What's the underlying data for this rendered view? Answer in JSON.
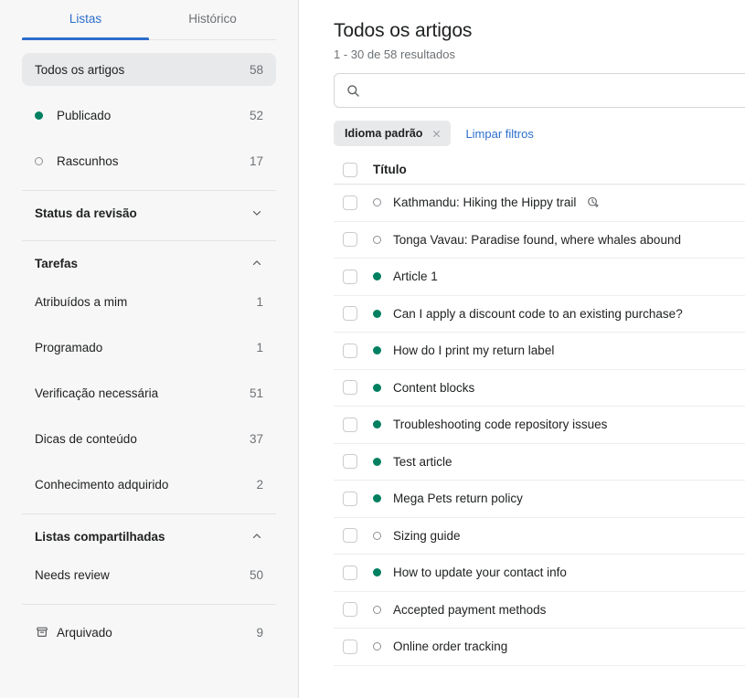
{
  "sidebar": {
    "tabs": [
      {
        "label": "Listas",
        "active": true
      },
      {
        "label": "Histórico",
        "active": false
      }
    ],
    "primary_items": [
      {
        "label": "Todos os artigos",
        "count": "58",
        "status": "none",
        "selected": true
      },
      {
        "label": "Publicado",
        "count": "52",
        "status": "published",
        "selected": false
      },
      {
        "label": "Rascunhos",
        "count": "17",
        "status": "draft",
        "selected": false
      }
    ],
    "sections": [
      {
        "title": "Status da revisão",
        "expanded": false,
        "chevron": "chevron-down-icon",
        "items": []
      },
      {
        "title": "Tarefas",
        "expanded": true,
        "chevron": "chevron-up-icon",
        "items": [
          {
            "label": "Atribuídos a mim",
            "count": "1"
          },
          {
            "label": "Programado",
            "count": "1"
          },
          {
            "label": "Verificação necessária",
            "count": "51"
          },
          {
            "label": "Dicas de conteúdo",
            "count": "37"
          },
          {
            "label": "Conhecimento adquirido",
            "count": "2"
          }
        ]
      },
      {
        "title": "Listas compartilhadas",
        "expanded": true,
        "chevron": "chevron-up-icon",
        "items": [
          {
            "label": "Needs review",
            "count": "50"
          }
        ]
      }
    ],
    "archived": {
      "label": "Arquivado",
      "count": "9",
      "icon": "archive-box-icon"
    }
  },
  "main": {
    "title": "Todos os artigos",
    "results_count": "1 - 30 de 58 resultados",
    "search": {
      "placeholder": "",
      "value": "",
      "icon": "search-icon"
    },
    "filters": {
      "chips": [
        {
          "label": "Idioma padrão",
          "remove_icon": "close-icon"
        }
      ],
      "clear_label": "Limpar filtros"
    },
    "table": {
      "columns": [
        "Título"
      ],
      "rows": [
        {
          "title": "Kathmandu: Hiking the Hippy trail",
          "status": "draft",
          "checked": false,
          "badge": "scheduled-clock-icon"
        },
        {
          "title": "Tonga Vavau: Paradise found, where whales abound",
          "status": "draft",
          "checked": false,
          "badge": ""
        },
        {
          "title": "Article 1",
          "status": "published",
          "checked": false,
          "badge": ""
        },
        {
          "title": "Can I apply a discount code to an existing purchase?",
          "status": "published",
          "checked": false,
          "badge": ""
        },
        {
          "title": "How do I print my return label",
          "status": "published",
          "checked": false,
          "badge": ""
        },
        {
          "title": "Content blocks",
          "status": "published",
          "checked": false,
          "badge": ""
        },
        {
          "title": "Troubleshooting code repository issues",
          "status": "published",
          "checked": false,
          "badge": ""
        },
        {
          "title": "Test article",
          "status": "published",
          "checked": false,
          "badge": ""
        },
        {
          "title": "Mega Pets return policy",
          "status": "published",
          "checked": false,
          "badge": ""
        },
        {
          "title": "Sizing guide",
          "status": "draft",
          "checked": false,
          "badge": ""
        },
        {
          "title": "How to update your contact info",
          "status": "published",
          "checked": false,
          "badge": ""
        },
        {
          "title": "Accepted payment methods",
          "status": "draft",
          "checked": false,
          "badge": ""
        },
        {
          "title": "Online order tracking",
          "status": "draft",
          "checked": false,
          "badge": ""
        }
      ]
    }
  },
  "colors": {
    "accent_blue": "#2c6ecb",
    "published_green": "#008060",
    "draft_gray": "#8c9196",
    "sidebar_bg": "#f7f7f7",
    "selected_bg": "#e8e9eb",
    "border": "#e1e3e5",
    "text": "#202223",
    "muted_text": "#6d7175"
  }
}
